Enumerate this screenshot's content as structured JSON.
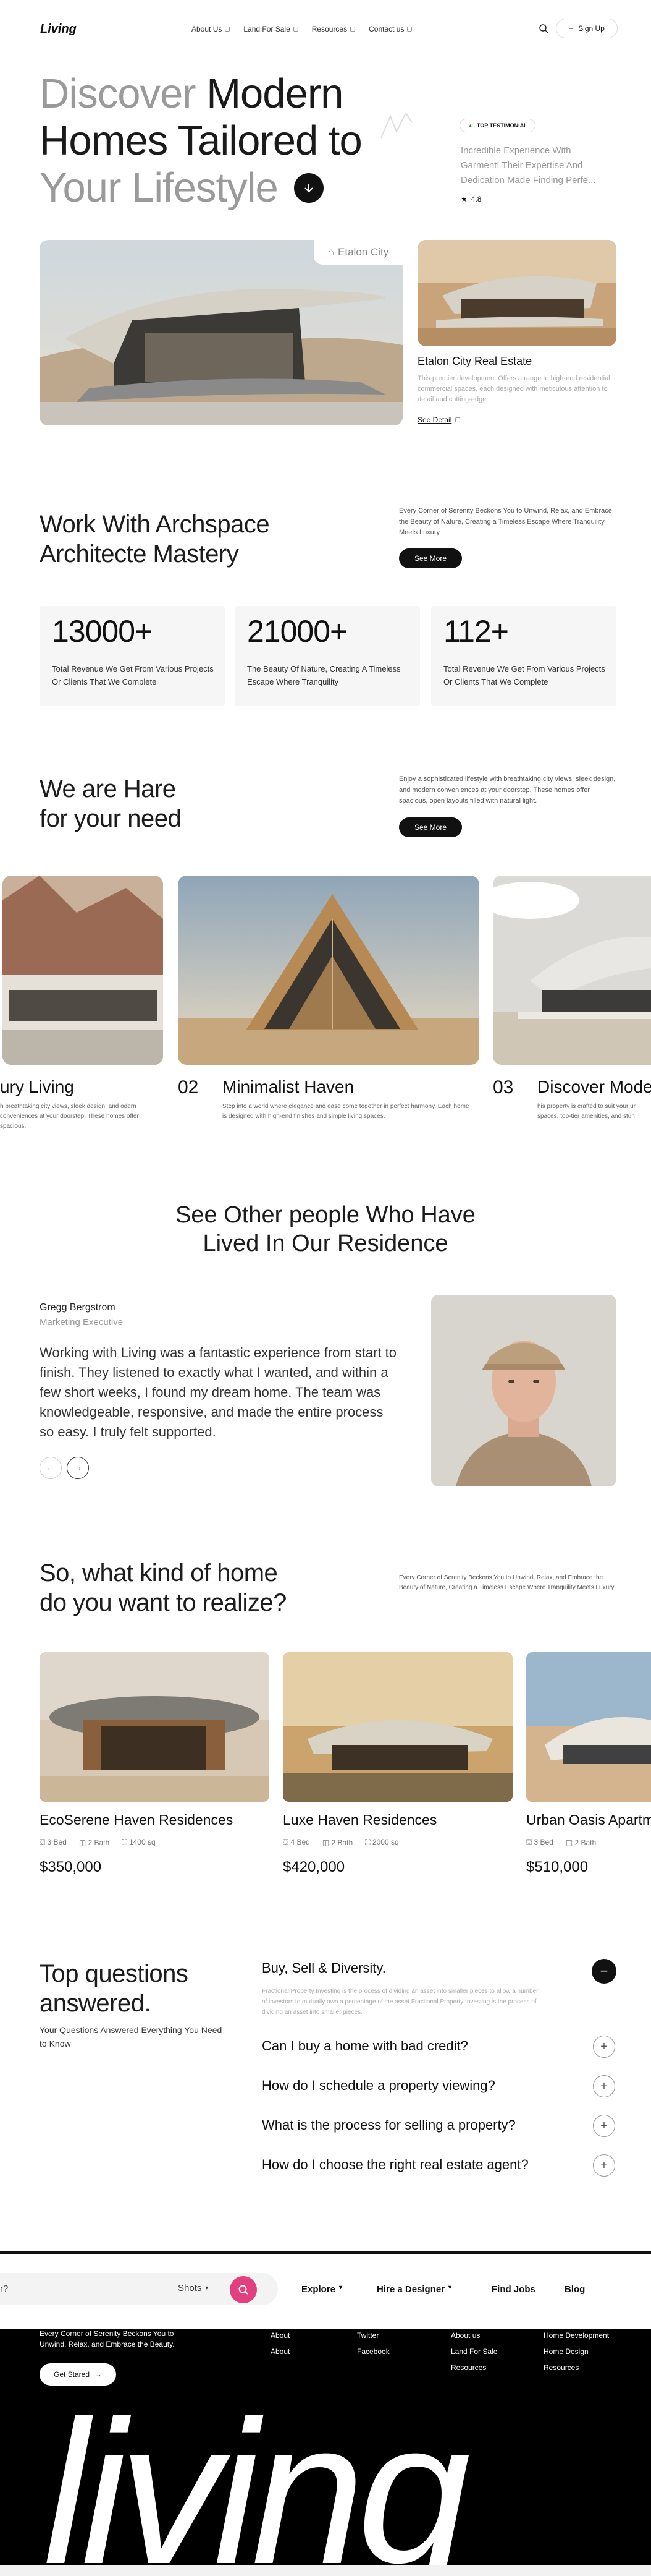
{
  "brand": "Living",
  "nav": {
    "items": [
      "About Us",
      "Land For Sale",
      "Resources",
      "Contact us"
    ],
    "signup": "Sign Up"
  },
  "hero": {
    "line1_light": "Discover",
    "line1_dark": "Modern",
    "line2": "Homes Tailored to",
    "line3": "Your Lifestyle",
    "badge": "TOP TESTIMONIAL",
    "testimonial": "Incredible Experience With Garment! Their Expertise And Dedication Made Finding Perfe...",
    "rating": "4.8",
    "image_tag": "Etalon City",
    "side_title": "Etalon City Real Estate",
    "side_desc": "This premier development Offers a range to high-end residential commercial spaces, each designed with meticulous attention to detail and cutting-edge",
    "side_link": "See Detail"
  },
  "mastery": {
    "title_l1": "Work With Archspace",
    "title_l2": "Architecte Mastery",
    "desc": "Every Corner of Serenity Beckons You to Unwind, Relax, and Embrace the Beauty of Nature, Creating a Timeless Escape Where Tranquility Meets Luxury",
    "button": "See More",
    "stats": [
      {
        "num": "13000+",
        "desc": "Total Revenue We Get From Various Projects Or Clients That We Complete"
      },
      {
        "num": "21000+",
        "desc": "The Beauty Of Nature, Creating A Timeless Escape Where Tranquility"
      },
      {
        "num": "112+",
        "desc": "Total Revenue We Get From Various Projects Or Clients That We Complete"
      }
    ]
  },
  "need": {
    "title_l1": "We are Hare",
    "title_l2": "for your need",
    "desc": "Enjoy a sophisticated lifestyle with breathtaking city views, sleek design, and modern conveniences at your doorstep. These homes offer spacious, open layouts filled with natural light.",
    "button": "See More",
    "cards": [
      {
        "num": "",
        "title": "ury Living",
        "desc": "h breathtaking city views, sleek design, and odern conveniences at your doorstep. These homes offer spacious."
      },
      {
        "num": "02",
        "title": "Minimalist Haven",
        "desc": "Step into a world where elegance and ease come together in perfect harmony. Each home is designed with high-end finishes and simple living spaces."
      },
      {
        "num": "03",
        "title": "Discover Mode",
        "desc": "his property is crafted to suit your ur spaces, top-tier amenities, and stun"
      }
    ]
  },
  "testimonial": {
    "title_l1": "See Other people Who Have",
    "title_l2": "Lived In Our Residence",
    "name": "Gregg Bergstrom",
    "role": "Marketing Executive",
    "quote": "Working with Living was a fantastic experience from start to finish. They listened to exactly what I wanted, and within a few short weeks, I found my dream home. The team was knowledgeable, responsive, and made the entire process so easy. I truly felt supported."
  },
  "homes": {
    "title_l1": "So, what kind of home",
    "title_l2": "do you want to realize?",
    "desc": "Every Corner of Serenity Beckons You to Unwind, Relax, and Embrace the Beauty of Nature, Creating a Timeless Escape Where Tranquility Meets Luxury",
    "items": [
      {
        "title": "EcoSerene Haven Residences",
        "bed": "3 Bed",
        "bath": "2 Bath",
        "area": "1400 sq",
        "price": "$350,000"
      },
      {
        "title": "Luxe Haven Residences",
        "bed": "4 Bed",
        "bath": "2 Bath",
        "area": "2000 sq",
        "price": "$420,000"
      },
      {
        "title": "Urban Oasis Apartm",
        "bed": "3 Bed",
        "bath": "2 Bath",
        "area": "",
        "price": "$510,000"
      }
    ]
  },
  "faq": {
    "title_l1": "Top questions",
    "title_l2": "answered.",
    "sub": "Your Questions Answered Everything You Need to Know",
    "open_q": "Buy, Sell & Diversity.",
    "open_a": "Fractional Property Investing is the process of dividing an asset into smaller pieces to allow a number of investors to mutually own a percentage of the asset Fractional Property Investing is the process of dividing an asset into smaller pieces.",
    "items": [
      "Can I buy a home with bad credit?",
      "How do I schedule a property viewing?",
      "What is the process for selling a property?",
      "How do I choose the right real estate agent?"
    ]
  },
  "searchbar": {
    "partial": "r?",
    "shots": "Shots",
    "explore": "Explore",
    "hire": "Hire a Designer",
    "jobs": "Find Jobs",
    "blog": "Blog"
  },
  "footer": {
    "desc": "Every Corner of Serenity Beckons You to Unwind, Relax, and Embrace the Beauty.",
    "cta": "Get Stared",
    "col1": [
      "About",
      "About"
    ],
    "col2": [
      "Twitter",
      "Facebook"
    ],
    "col3": [
      "About us",
      "Land For Sale",
      "Resources"
    ],
    "col4": [
      "Home Development",
      "Home Design",
      "Resources"
    ],
    "big": "living"
  },
  "colors": {
    "accent": "#e23f7e",
    "dark": "#111111",
    "grey_text": "#9a9a9a"
  }
}
